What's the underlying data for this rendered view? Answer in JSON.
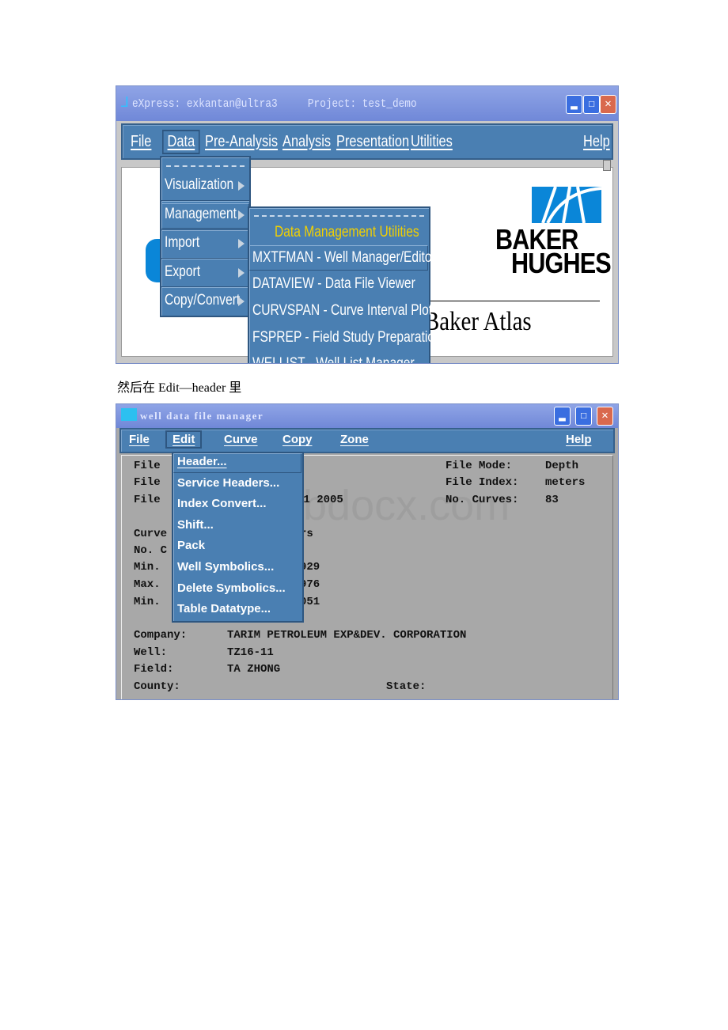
{
  "screenshot1": {
    "title": "eXpress: exkantan@ultra3     Project: test_demo",
    "menubar": [
      "File",
      "Data",
      "Pre-Analysis",
      "Analysis",
      "Presentation",
      "Utilities",
      "Help"
    ],
    "data_menu": [
      "Visualization",
      "Management",
      "Import",
      "Export",
      "Copy/Convert"
    ],
    "submenu_title": "Data Management Utilities",
    "submenu": [
      "MXTFMAN - Well Manager/Editor",
      "DATAVIEW - Data File Viewer",
      "CURVSPAN - Curve Interval Plot",
      "FSPREP - Field Study Preparation",
      "WELLIST - Well List Manager"
    ],
    "logo_line1": "BAKER",
    "logo_line2": "HUGHES",
    "atlas": "Baker Atlas",
    "colors": {
      "menu": "#4a7fb2",
      "submenu_title": "#f2d000",
      "titlebar": "#7f96de"
    }
  },
  "caption": "然后在 Edit—header 里",
  "screenshot2": {
    "title": "well data file manager",
    "menubar": [
      "File",
      "Edit",
      "Curve",
      "Copy",
      "Zone",
      "Help"
    ],
    "edit_menu": [
      "Header...",
      "Service Headers...",
      "Index Convert...",
      "Shift...",
      "Pack",
      "Well Symbolics...",
      "Delete Symbolics...",
      "Table Datatype..."
    ],
    "left_labels": [
      "File",
      "File",
      "File",
      "Curve",
      "No. C",
      "Min.",
      "Max.",
      "Min."
    ],
    "partial_values": [
      "11 2005",
      "rs",
      "929",
      "976",
      "051"
    ],
    "right_fields": [
      {
        "label": "File Mode:",
        "value": "Depth"
      },
      {
        "label": "File Index:",
        "value": "meters"
      },
      {
        "label": "No. Curves:",
        "value": "83"
      }
    ],
    "info": [
      {
        "label": "Company:",
        "value": "TARIM PETROLEUM EXP&DEV. CORPORATION"
      },
      {
        "label": "Well:",
        "value": "TZ16-11"
      },
      {
        "label": "Field:",
        "value": "TA ZHONG"
      },
      {
        "label": "County:",
        "value": ""
      }
    ],
    "state_label": "State:",
    "watermark": "www.bdocx.com"
  }
}
